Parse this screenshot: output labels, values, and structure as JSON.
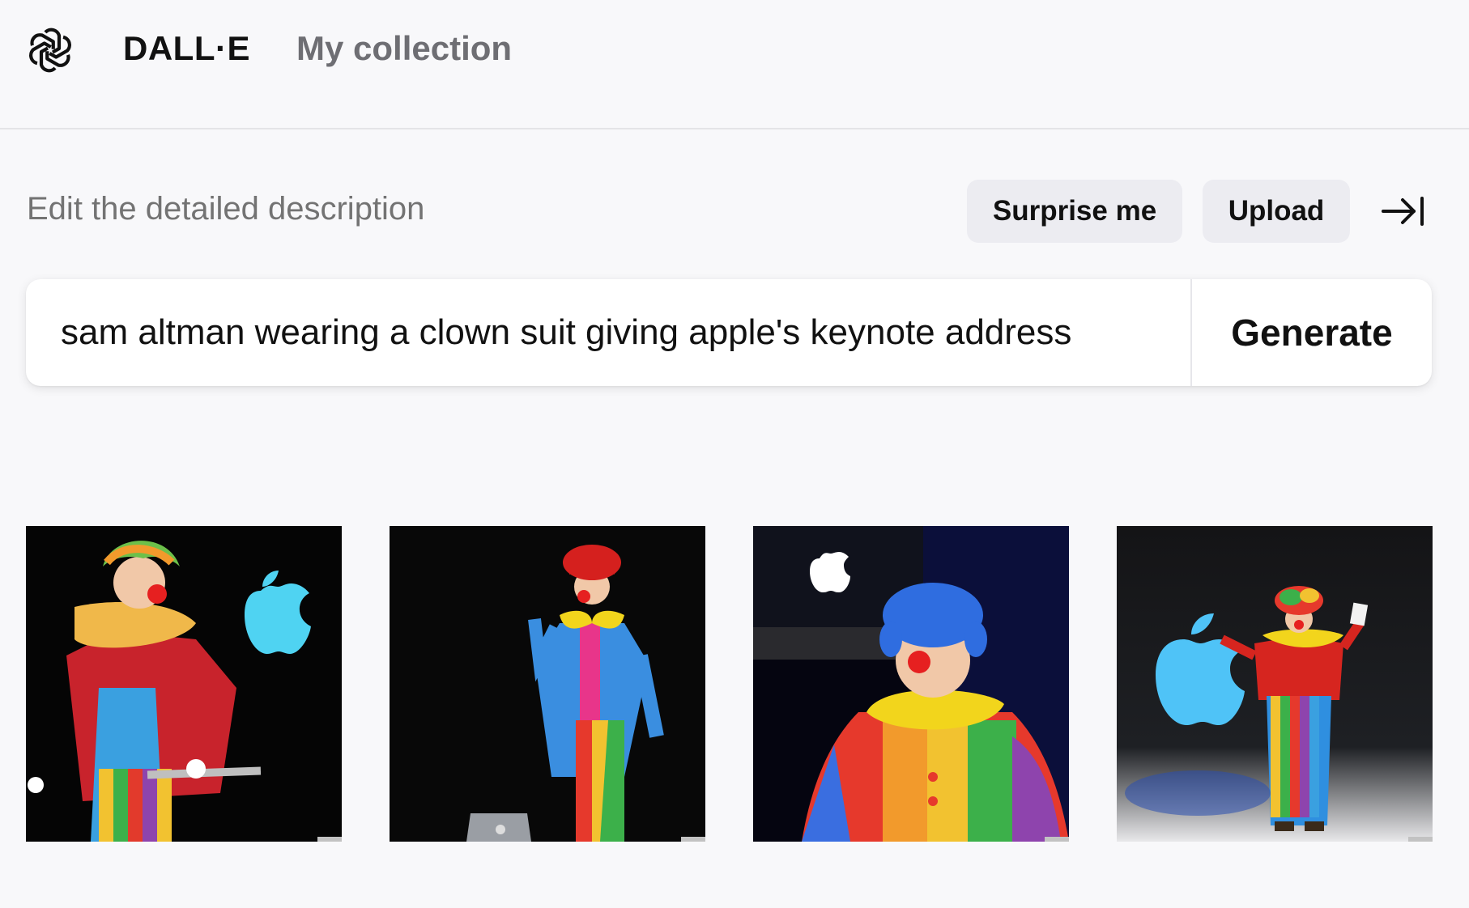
{
  "header": {
    "brand": "DALL·E",
    "nav_collection": "My collection",
    "logo_icon": "openai-logo-icon"
  },
  "editor": {
    "label": "Edit the detailed description",
    "surprise_label": "Surprise me",
    "upload_label": "Upload",
    "collapse_icon": "arrow-right-to-bar-icon",
    "prompt_value": "sam altman wearing a clown suit giving apple's keynote address",
    "generate_label": "Generate"
  },
  "results": {
    "images": [
      {
        "name": "clown-rainbow-wig-laptop"
      },
      {
        "name": "clown-red-wig-bowtie"
      },
      {
        "name": "clown-blue-wig-closeup"
      },
      {
        "name": "clown-apple-logo-stage"
      }
    ]
  },
  "colors": {
    "background": "#f8f8fa",
    "button_bg": "#ececf1",
    "muted_text": "#737373",
    "nav_text": "#6e6e73",
    "apple_blue": "#4fc3f7"
  }
}
